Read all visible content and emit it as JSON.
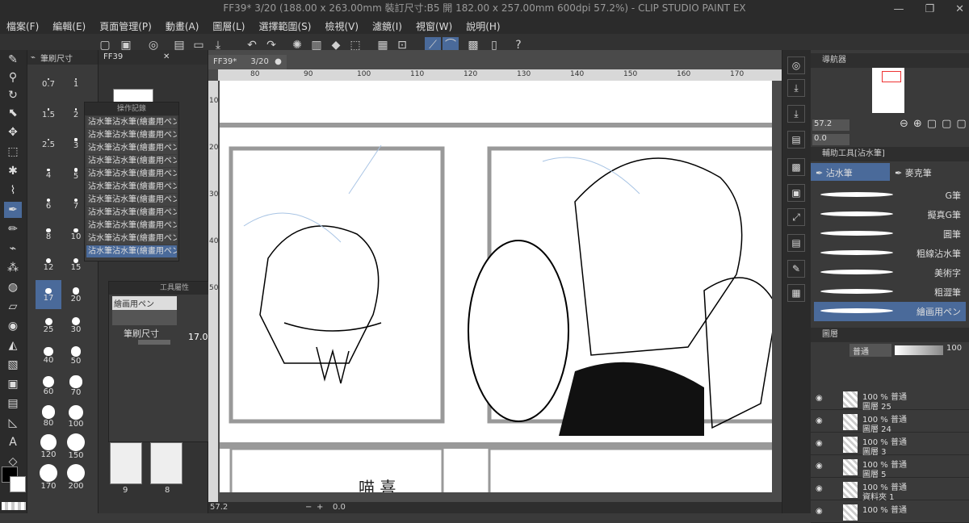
{
  "window": {
    "title": "FF39* 3/20 (188.00 x 263.00mm 裝訂尺寸:B5 開 182.00 x 257.00mm 600dpi 57.2%) - CLIP STUDIO PAINT EX",
    "minimize": "—",
    "maximize": "❐",
    "close": "✕"
  },
  "menu": [
    "檔案(F)",
    "編輯(E)",
    "頁面管理(P)",
    "動畫(A)",
    "圖層(L)",
    "選擇範圍(S)",
    "檢視(V)",
    "濾鏡(I)",
    "視窗(W)",
    "說明(H)"
  ],
  "subtool_panel": {
    "tab_label": "筆刷尺寸"
  },
  "brush_sizes": [
    {
      "v": "0.7"
    },
    {
      "v": "1"
    },
    {
      "v": "1.5"
    },
    {
      "v": "2"
    },
    {
      "v": "2.5"
    },
    {
      "v": "3"
    },
    {
      "v": "4"
    },
    {
      "v": "5"
    },
    {
      "v": "6"
    },
    {
      "v": "7"
    },
    {
      "v": "8"
    },
    {
      "v": "10"
    },
    {
      "v": "12"
    },
    {
      "v": "15"
    },
    {
      "v": "17"
    },
    {
      "v": "20"
    },
    {
      "v": "25"
    },
    {
      "v": "30"
    },
    {
      "v": "40"
    },
    {
      "v": "50"
    },
    {
      "v": "60"
    },
    {
      "v": "70"
    },
    {
      "v": "80"
    },
    {
      "v": "100"
    },
    {
      "v": "120"
    },
    {
      "v": "150"
    },
    {
      "v": "170"
    },
    {
      "v": "200"
    }
  ],
  "pages_panel": {
    "tab_label": "FF39",
    "page_numbers": [
      "9",
      "8"
    ]
  },
  "history": {
    "title": "操作記錄",
    "items": [
      "沾水筆沾水筆(繪畫用ペン)",
      "沾水筆沾水筆(繪畫用ペン)",
      "沾水筆沾水筆(繪畫用ペン)",
      "沾水筆沾水筆(繪畫用ペン)",
      "沾水筆沾水筆(繪畫用ペン)",
      "沾水筆沾水筆(繪畫用ペン)",
      "沾水筆沾水筆(繪畫用ペン)",
      "沾水筆沾水筆(繪畫用ペン)",
      "沾水筆沾水筆(繪畫用ペン)",
      "沾水筆沾水筆(繪畫用ペン)",
      "沾水筆沾水筆(繪畫用ペン)"
    ]
  },
  "tool_property": {
    "title": "工具屬性",
    "tool_name": "繪画用ペン",
    "size_label": "筆刷尺寸",
    "size_value": "17.0"
  },
  "canvas": {
    "tab_name": "FF39*",
    "tab_page": "3/20",
    "zoom": "57.2",
    "angle": "0.0",
    "ruler_top": [
      "80",
      "90",
      "100",
      "110",
      "120",
      "130",
      "140",
      "150",
      "160",
      "170"
    ],
    "ruler_left": [
      "10",
      "20",
      "30",
      "40",
      "50"
    ],
    "text": "喵 喜"
  },
  "navigator": {
    "title": "導航器",
    "zoom": "57.2",
    "angle": "0.0"
  },
  "subtool": {
    "title": "輔助工具[沾水筆]",
    "tabs": [
      "沾水筆",
      "麥克筆"
    ],
    "brushes": [
      "G筆",
      "擬真G筆",
      "圓筆",
      "粗線沾水筆",
      "美術字",
      "粗澀筆",
      "繪画用ペン"
    ]
  },
  "layers": {
    "tabs": [
      "圖層",
      "",
      ""
    ],
    "blend_mode": "普通",
    "opacity": "100",
    "rows": [
      {
        "pct": "100 % 普通",
        "name": "圖層 25"
      },
      {
        "pct": "100 % 普通",
        "name": "圖層 24"
      },
      {
        "pct": "100 % 普通",
        "name": "圖層 3"
      },
      {
        "pct": "100 % 普通",
        "name": "圖層 5"
      },
      {
        "pct": "100 % 普通",
        "name": "資料夾 1"
      },
      {
        "pct": "100 % 普通",
        "name": ""
      }
    ]
  }
}
